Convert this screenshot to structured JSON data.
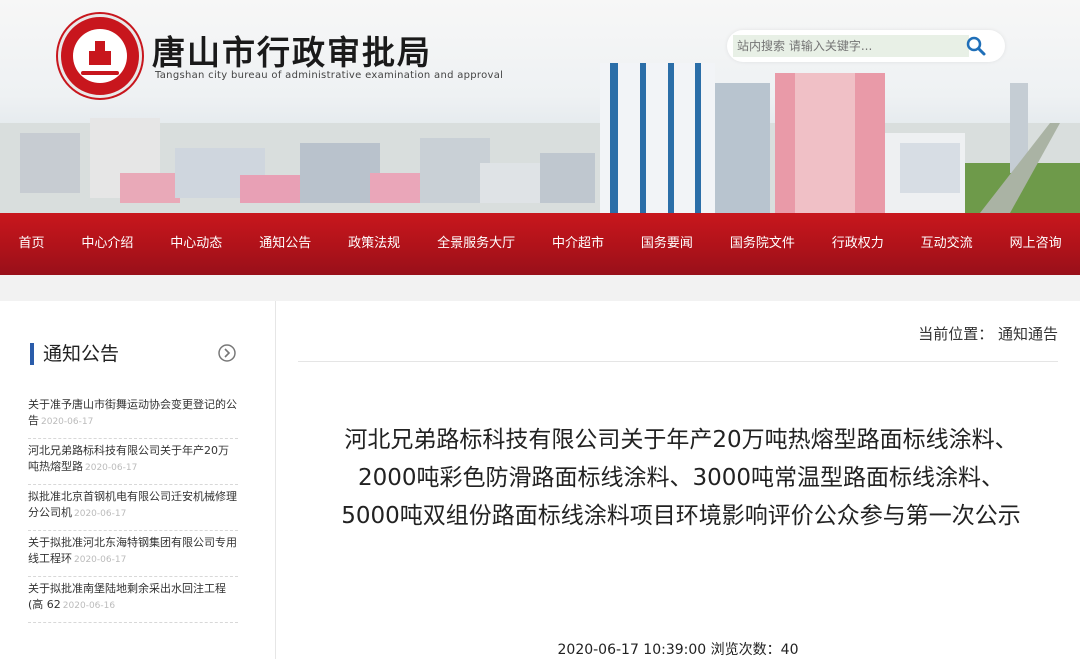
{
  "header": {
    "site_title": "唐山市行政审批局",
    "site_subtitle": "Tangshan city bureau of administrative examination and approval",
    "search_placeholder": "站内搜索 请输入关键字..."
  },
  "nav": {
    "items": [
      "首页",
      "中心介绍",
      "中心动态",
      "通知公告",
      "政策法规",
      "全景服务大厅",
      "中介超市",
      "国务要闻",
      "国务院文件",
      "行政权力",
      "互动交流",
      "网上咨询"
    ]
  },
  "sidebar": {
    "title": "通知公告",
    "items": [
      {
        "text": "关于准予唐山市街舞运动协会变更登记的公告",
        "date": "2020-06-17"
      },
      {
        "text": "河北兄弟路标科技有限公司关于年产20万吨热熔型路",
        "date": "2020-06-17"
      },
      {
        "text": "拟批准北京首钢机电有限公司迁安机械修理分公司机",
        "date": "2020-06-17"
      },
      {
        "text": "关于拟批准河北东海特钢集团有限公司专用线工程环",
        "date": "2020-06-17"
      },
      {
        "text": "关于拟批准南堡陆地剩余采出水回注工程(高 62",
        "date": "2020-06-16"
      }
    ]
  },
  "main": {
    "breadcrumb_label": "当前位置：",
    "breadcrumb_current": "通知通告",
    "article_title": "河北兄弟路标科技有限公司关于年产20万吨热熔型路面标线涂料、2000吨彩色防滑路面标线涂料、3000吨常温型路面标线涂料、5000吨双组份路面标线涂料项目环境影响评价公众参与第一次公示",
    "meta_datetime": "2020-06-17 10:39:00",
    "meta_views_label": "浏览次数：",
    "meta_views": "40"
  },
  "colors": {
    "nav_red": "#b0121a",
    "accent_blue": "#2a5caa"
  }
}
